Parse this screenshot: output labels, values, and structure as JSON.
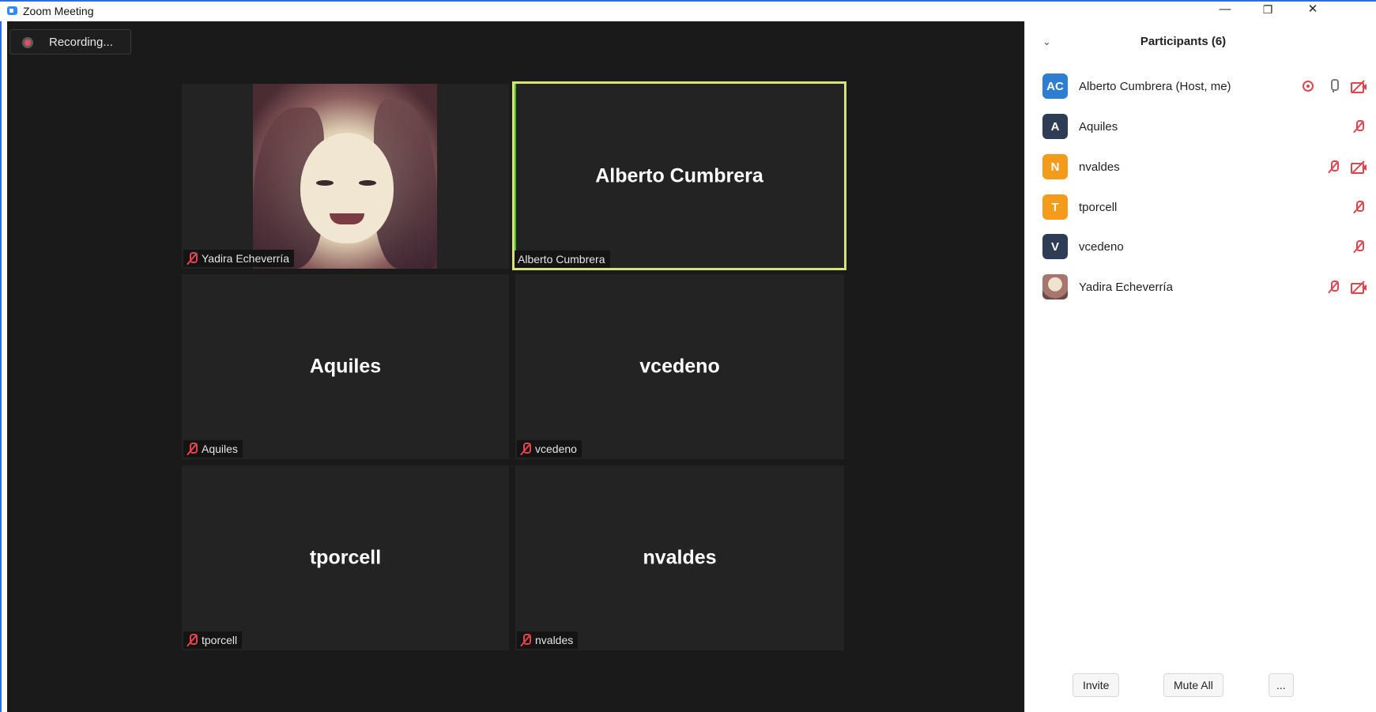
{
  "window": {
    "title": "Zoom Meeting",
    "minimize_glyph": "—",
    "restore_glyph": "❐",
    "close_glyph": "✕"
  },
  "recording": {
    "label": "Recording..."
  },
  "tiles": [
    {
      "display_name": "",
      "label": "Yadira Echeverría",
      "muted": true,
      "has_video": true
    },
    {
      "display_name": "Alberto Cumbrera",
      "label": "Alberto Cumbrera",
      "muted": false,
      "active_speaker": true
    },
    {
      "display_name": "Aquiles",
      "label": "Aquiles",
      "muted": true
    },
    {
      "display_name": "vcedeno",
      "label": "vcedeno",
      "muted": true
    },
    {
      "display_name": "tporcell",
      "label": "tporcell",
      "muted": true
    },
    {
      "display_name": "nvaldes",
      "label": "nvaldes",
      "muted": true
    }
  ],
  "panel": {
    "title": "Participants (6)",
    "chevron": "⌄",
    "participants": [
      {
        "initials": "AC",
        "name": "Alberto Cumbrera (Host, me)",
        "avatar_color": "#2d7dd2",
        "icons": [
          "recording-indicator-icon",
          "mic-icon",
          "video-off-icon"
        ]
      },
      {
        "initials": "A",
        "name": "Aquiles",
        "avatar_color": "#2e3d55",
        "icons": [
          "mic-muted-icon"
        ]
      },
      {
        "initials": "N",
        "name": "nvaldes",
        "avatar_color": "#f39b1b",
        "icons": [
          "mic-muted-icon",
          "video-off-icon"
        ]
      },
      {
        "initials": "T",
        "name": "tporcell",
        "avatar_color": "#f39b1b",
        "icons": [
          "mic-muted-icon"
        ]
      },
      {
        "initials": "V",
        "name": "vcedeno",
        "avatar_color": "#2e3d55",
        "icons": [
          "mic-muted-icon"
        ]
      },
      {
        "initials": "",
        "name": "Yadira Echeverría",
        "avatar_color": "#c9a98f",
        "icons": [
          "mic-muted-icon",
          "video-off-icon"
        ]
      }
    ],
    "buttons": {
      "invite": "Invite",
      "mute_all": "Mute All",
      "more": "..."
    }
  },
  "colors": {
    "active_speaker_border": "#d8e27a",
    "muted_red": "#e0454f",
    "stage_bg": "#1a1a1a",
    "tile_bg": "#232323"
  }
}
